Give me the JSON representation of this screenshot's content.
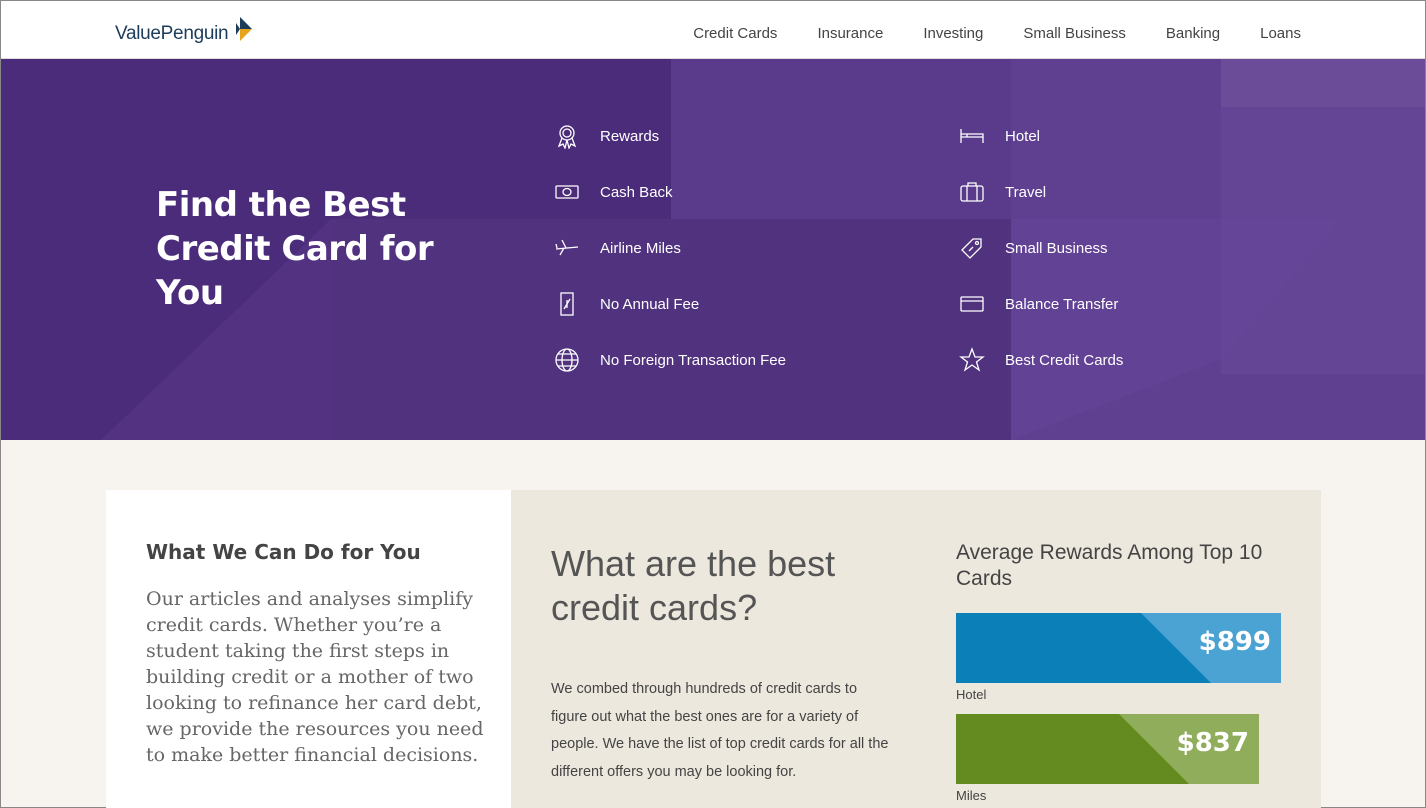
{
  "header": {
    "logo_text": "ValuePenguin",
    "nav": [
      "Credit Cards",
      "Insurance",
      "Investing",
      "Small Business",
      "Banking",
      "Loans"
    ]
  },
  "hero": {
    "title": "Find the Best Credit Card for You",
    "categories_left": [
      {
        "label": "Rewards",
        "icon": "award-ribbon-icon"
      },
      {
        "label": "Cash Back",
        "icon": "cash-icon"
      },
      {
        "label": "Airline Miles",
        "icon": "airplane-icon"
      },
      {
        "label": "No Annual Fee",
        "icon": "no-fee-icon"
      },
      {
        "label": "No Foreign Transaction Fee",
        "icon": "globe-icon"
      }
    ],
    "categories_right": [
      {
        "label": "Hotel",
        "icon": "bed-icon"
      },
      {
        "label": "Travel",
        "icon": "suitcase-icon"
      },
      {
        "label": "Small Business",
        "icon": "tag-icon"
      },
      {
        "label": "Balance Transfer",
        "icon": "card-icon"
      },
      {
        "label": "Best Credit Cards",
        "icon": "star-icon"
      }
    ]
  },
  "about": {
    "heading": "What We Can Do for You",
    "body": "Our articles and analyses simplify credit cards. Whether you’re a student taking the first steps in building credit or a mother of two looking to refinance her card debt, we provide the resources you need to make better financial decisions."
  },
  "best": {
    "heading": "What are the best credit cards?",
    "body": "We combed through hundreds of credit cards to figure out what the best ones are for a variety of people. We have the list of top credit cards for all the different offers you may be looking for."
  },
  "rewards": {
    "title": "Average Rewards Among Top 10 Cards",
    "bars": [
      {
        "label": "Hotel",
        "value": "$899",
        "amount": 899,
        "color": "#0a7fb8",
        "accent": "#4aa3d3"
      },
      {
        "label": "Miles",
        "value": "$837",
        "amount": 837,
        "color": "#648b1f",
        "accent": "#90ad5c"
      }
    ]
  }
}
